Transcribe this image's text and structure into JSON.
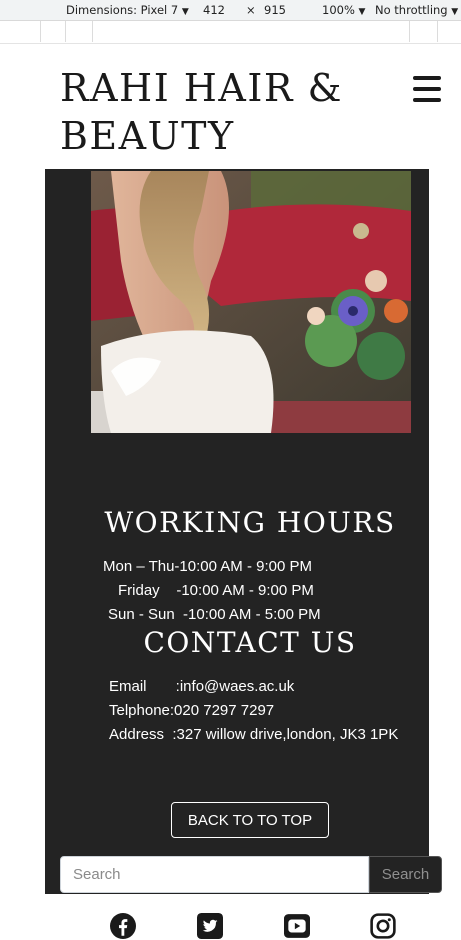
{
  "devtools": {
    "device_label": "Dimensions: Pixel 7",
    "width": "412",
    "times": "×",
    "height": "915",
    "zoom": "100%",
    "throttle": "No throttling"
  },
  "header": {
    "brand_line1": "RAHI HAIR &",
    "brand_line2": "BEAUTY",
    "menu_icon": "hamburger-menu-icon"
  },
  "hero": {
    "image": "bride-with-bouquet-photo"
  },
  "working_hours": {
    "title": "WORKING HOURS",
    "rows": [
      "Mon – Thu-10:00 AM - 9:00 PM",
      "Friday    -10:00 AM - 9:00 PM",
      "Sun - Sun  -10:00 AM - 5:00 PM"
    ]
  },
  "contact": {
    "title": "CONTACT US",
    "rows": [
      "Email       :info@waes.ac.uk",
      "Telphone:020 7297 7297",
      "Address  :327 willow drive,london, JK3 1PK"
    ]
  },
  "back_to_top": {
    "label": "BACK TO TO TOP"
  },
  "search": {
    "placeholder": "Search",
    "button_label": "Search"
  },
  "social": [
    "facebook-icon",
    "twitter-icon",
    "youtube-icon",
    "instagram-icon"
  ],
  "colors": {
    "dark_bg": "#232323",
    "text_light": "#ffffff",
    "text_dark": "#1a1a1a"
  }
}
